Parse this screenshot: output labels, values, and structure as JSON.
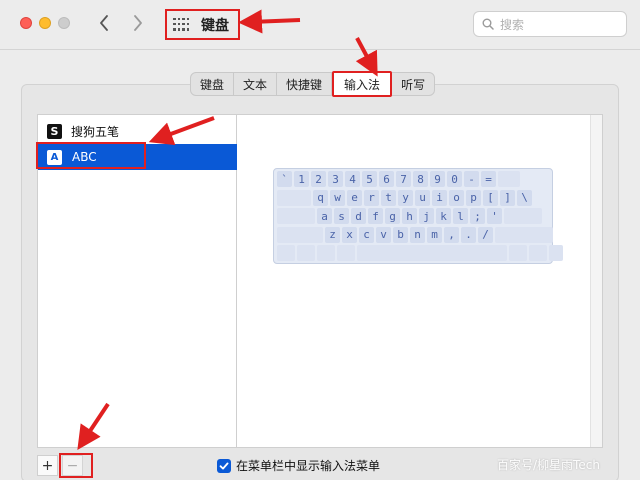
{
  "window": {
    "title": "键盘",
    "nav_back_icon": "chevron-left-icon",
    "nav_forward_icon": "chevron-right-icon",
    "title_icon": "grid-icon",
    "search_placeholder": "搜索"
  },
  "tabs": [
    {
      "label": "键盘"
    },
    {
      "label": "文本"
    },
    {
      "label": "快捷键"
    },
    {
      "label": "输入法",
      "active": true
    },
    {
      "label": "听写"
    }
  ],
  "input_sources": [
    {
      "label": "搜狗五笔",
      "icon_glyph": "S",
      "icon": "sogou-icon"
    },
    {
      "label": "ABC",
      "icon_glyph": "A",
      "icon": "abc-icon",
      "selected": true
    }
  ],
  "keyboard_layout": {
    "row1": [
      "`",
      "1",
      "2",
      "3",
      "4",
      "5",
      "6",
      "7",
      "8",
      "9",
      "0",
      "-",
      "="
    ],
    "row2": [
      "q",
      "w",
      "e",
      "r",
      "t",
      "y",
      "u",
      "i",
      "o",
      "p",
      "[",
      "]",
      "\\"
    ],
    "row3": [
      "a",
      "s",
      "d",
      "f",
      "g",
      "h",
      "j",
      "k",
      "l",
      ";",
      "'"
    ],
    "row4": [
      "z",
      "x",
      "c",
      "v",
      "b",
      "n",
      "m",
      ",",
      ".",
      "/"
    ]
  },
  "footer": {
    "add_label": "+",
    "remove_label": "−",
    "show_menu_checked": true,
    "show_menu_label": "在菜单栏中显示输入法菜单"
  },
  "watermark": "百家号/柳星雨Tech",
  "colors": {
    "accent": "#0a59d6",
    "annotation": "#e02020",
    "key_text": "#4a63a8"
  }
}
